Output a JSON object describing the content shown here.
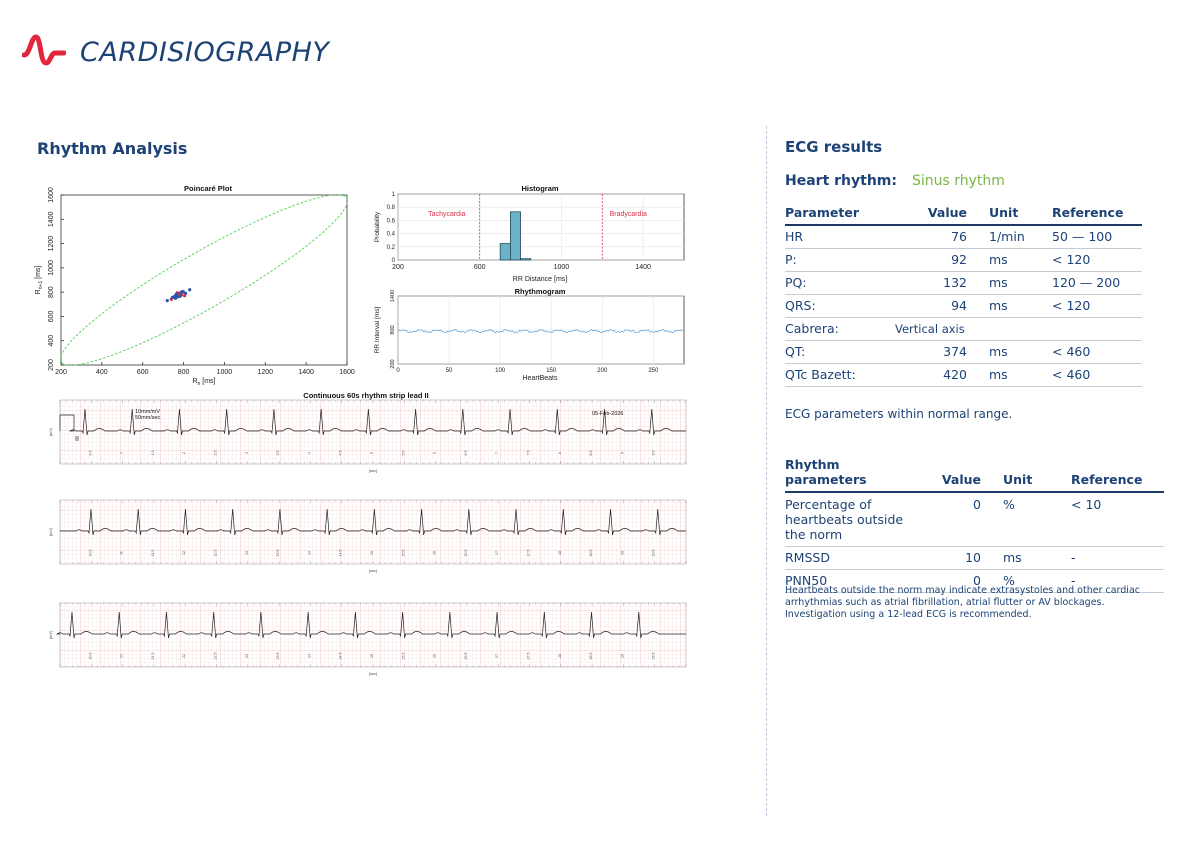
{
  "header": {
    "brand": "CARDISIOGRAPHY",
    "logo_icon": "heartbeat-wave-icon",
    "brand_color": "#1d4275",
    "logo_color": "#e3263b"
  },
  "left": {
    "title": "Rhythm Analysis",
    "poincare": {
      "title": "Poincaré Plot",
      "xlabel": "R",
      "xlabel_sub": "n",
      "xlabel_unit": " [ms]",
      "ylabel": "R",
      "ylabel_sub": "n+1",
      "ylabel_unit": " [ms]",
      "ticks": [
        "200",
        "400",
        "600",
        "800",
        "1000",
        "1200",
        "1400",
        "1600"
      ],
      "tick_values": [
        200,
        400,
        600,
        800,
        1000,
        1200,
        1400,
        1600
      ]
    },
    "histogram": {
      "title": "Histogram",
      "xlabel": "RR Distance [ms]",
      "ylabel": "Probability",
      "xticks": [
        "200",
        "600",
        "1000",
        "1400"
      ],
      "xtick_values": [
        200,
        600,
        1000,
        1400
      ],
      "yticks": [
        "0",
        "0.2",
        "0.4",
        "0.6",
        "0.8",
        "1"
      ],
      "ytick_values": [
        0,
        0.2,
        0.4,
        0.6,
        0.8,
        1
      ],
      "tachy_label": "Tachycardia",
      "brady_label": "Bradycardia"
    },
    "rhythmogram": {
      "title": "Rhythmogram",
      "xlabel": "HeartBeats",
      "ylabel": "RR Interval [ms]",
      "xticks": [
        "0",
        "50",
        "100",
        "150",
        "200",
        "250"
      ],
      "xtick_values": [
        0,
        50,
        100,
        150,
        200,
        250
      ],
      "yticks": [
        "200",
        "800",
        "1400"
      ],
      "ytick_values": [
        200,
        800,
        1400
      ]
    },
    "strip": {
      "title": "Continuous 60s rhythm strip lead II",
      "scale_label_1": "10mm/mV",
      "scale_label_2": "50mm/sec",
      "date": "05-Feb-2026",
      "lead": "II",
      "unit_y": "[mV]",
      "unit_x": "[sec]",
      "ticks_1": [
        "0.5",
        "1",
        "1.5",
        "2",
        "2.5",
        "3",
        "3.5",
        "4",
        "4.5",
        "5",
        "5.5",
        "6",
        "6.5",
        "7",
        "7.5",
        "8",
        "8.5",
        "9",
        "9.5"
      ],
      "ticks_2": [
        "10.5",
        "11",
        "11.5",
        "12",
        "12.5",
        "13",
        "13.5",
        "14",
        "14.5",
        "15",
        "15.5",
        "16",
        "16.5",
        "17",
        "17.5",
        "18",
        "18.5",
        "19",
        "19.5"
      ],
      "ticks_3": [
        "20.5",
        "21",
        "21.5",
        "22",
        "22.5",
        "23",
        "23.5",
        "24",
        "24.5",
        "25",
        "25.5",
        "26",
        "26.5",
        "27",
        "27.5",
        "28",
        "28.5",
        "29",
        "29.5"
      ]
    }
  },
  "chart_data": [
    {
      "type": "scatter",
      "title": "Poincaré Plot",
      "xlabel": "Rn [ms]",
      "ylabel": "Rn+1 [ms]",
      "xlim": [
        200,
        1600
      ],
      "ylim": [
        200,
        1600
      ],
      "cluster_center": [
        780,
        780
      ],
      "points": [
        [
          740,
          740
        ],
        [
          760,
          770
        ],
        [
          770,
          760
        ],
        [
          780,
          790
        ],
        [
          790,
          780
        ],
        [
          800,
          800
        ],
        [
          760,
          750
        ],
        [
          785,
          770
        ],
        [
          770,
          795
        ],
        [
          810,
          790
        ],
        [
          750,
          760
        ],
        [
          795,
          805
        ],
        [
          775,
          775
        ],
        [
          720,
          730
        ],
        [
          830,
          820
        ],
        [
          765,
          785
        ],
        [
          805,
          770
        ],
        [
          745,
          755
        ],
        [
          790,
          800
        ],
        [
          780,
          765
        ]
      ],
      "ellipse": {
        "center": [
          900,
          900
        ],
        "major_axis_ms": 1950,
        "minor_axis_ms": 380,
        "angle_deg": 45
      }
    },
    {
      "type": "bar",
      "title": "Histogram",
      "xlabel": "RR Distance [ms]",
      "ylabel": "Probability",
      "xlim": [
        200,
        1600
      ],
      "ylim": [
        0,
        1
      ],
      "bins": [
        {
          "x0": 700,
          "x1": 750,
          "value": 0.25
        },
        {
          "x0": 750,
          "x1": 800,
          "value": 0.73
        },
        {
          "x0": 800,
          "x1": 850,
          "value": 0.02
        }
      ],
      "thresholds": {
        "tachycardia_ms": 600,
        "bradycardia_ms": 1200
      }
    },
    {
      "type": "line",
      "title": "Rhythmogram",
      "xlabel": "HeartBeats",
      "ylabel": "RR Interval [ms]",
      "xlim": [
        0,
        280
      ],
      "ylim": [
        200,
        1400
      ],
      "baseline_ms": 780,
      "beats": 280
    }
  ],
  "right": {
    "title": "ECG results",
    "heart_rhythm_label": "Heart rhythm:",
    "heart_rhythm_value": "Sinus rhythm",
    "params": {
      "headers": [
        "Parameter",
        "Value",
        "Unit",
        "Reference"
      ],
      "rows": [
        {
          "name": "HR",
          "value": "76",
          "unit": "1/min",
          "ref": "50 — 100"
        },
        {
          "name": "P:",
          "value": "92",
          "unit": "ms",
          "ref": "< 120"
        },
        {
          "name": "PQ:",
          "value": "132",
          "unit": "ms",
          "ref": "120 — 200"
        },
        {
          "name": "QRS:",
          "value": "94",
          "unit": "ms",
          "ref": "< 120"
        },
        {
          "name": "Cabrera:",
          "value": "Vertical axis",
          "unit": "",
          "ref": ""
        },
        {
          "name": "QT:",
          "value": "374",
          "unit": "ms",
          "ref": "< 460"
        },
        {
          "name": "QTc Bazett:",
          "value": "420",
          "unit": "ms",
          "ref": "< 460"
        }
      ]
    },
    "normal_note": "ECG parameters within normal range.",
    "rhythm": {
      "headers": [
        "Rhythm parameters",
        "Value",
        "Unit",
        "Reference"
      ],
      "rows": [
        {
          "name": "Percentage of heartbeats outside the norm",
          "value": "0",
          "unit": "%",
          "ref": "< 10"
        },
        {
          "name": "RMSSD",
          "value": "10",
          "unit": "ms",
          "ref": "-"
        },
        {
          "name": "PNN50",
          "value": "0",
          "unit": "%",
          "ref": "-"
        }
      ]
    },
    "footnote": "Heartbeats outside the norm may indicate extrasystoles and other cardiac arrhythmias such as atrial fibrillation, atrial flutter or AV blockages. Investigation using a 12-lead ECG is recommended."
  }
}
